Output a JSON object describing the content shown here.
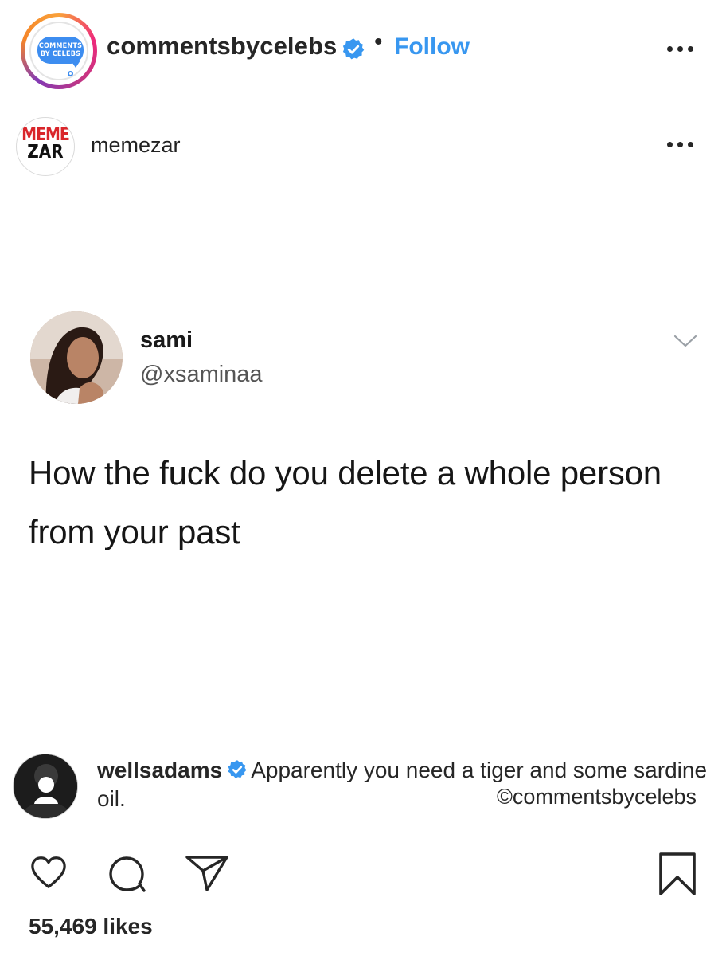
{
  "header": {
    "account_name": "commentsbycelebs",
    "separator": "•",
    "follow_label": "Follow",
    "logo_line1": "COMMENTS",
    "logo_line2": "BY CELEBS",
    "verified_icon": "verified-badge-icon",
    "more_icon": "more-options-icon",
    "accent_color": "#3897f0"
  },
  "post": {
    "source_account": "memezar",
    "source_logo_line1": "MEME",
    "source_logo_line2": "ZAR",
    "tweet": {
      "name": "sami",
      "handle": "@xsaminaa",
      "text": "How the fuck do you delete a whole person from your past",
      "chevron_icon": "chevron-down-icon"
    }
  },
  "caption": {
    "username": "wellsadams",
    "text": "Apparently you need a tiger and some sardine oil.",
    "credit": "©commentsbycelebs"
  },
  "actions": {
    "icons": [
      "heart-icon",
      "comment-icon",
      "share-icon",
      "bookmark-icon"
    ]
  },
  "likes": "55,469 likes"
}
